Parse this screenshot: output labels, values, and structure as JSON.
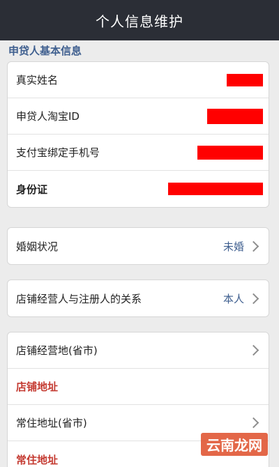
{
  "header": {
    "title": "个人信息维护"
  },
  "section": {
    "label": "申贷人基本信息"
  },
  "basic_info": {
    "rows": [
      {
        "label": "真实姓名"
      },
      {
        "label": "申贷人淘宝ID"
      },
      {
        "label": "支付宝绑定手机号"
      },
      {
        "label": "身份证"
      }
    ]
  },
  "marital": {
    "label": "婚姻状况",
    "value": "未婚"
  },
  "relation": {
    "label": "店铺经营人与注册人的关系",
    "value": "本人"
  },
  "address": {
    "rows": [
      {
        "label": "店铺经营地(省市)"
      },
      {
        "label": "店铺地址"
      },
      {
        "label": "常住地址(省市)"
      },
      {
        "label": "常住地址"
      }
    ]
  },
  "colors": {
    "header_bg": "#2b2e36",
    "accent": "#3f5f8f",
    "required_red": "#c43a31",
    "redaction": "#ff0000"
  },
  "watermark": {
    "text": "云南龙网"
  }
}
